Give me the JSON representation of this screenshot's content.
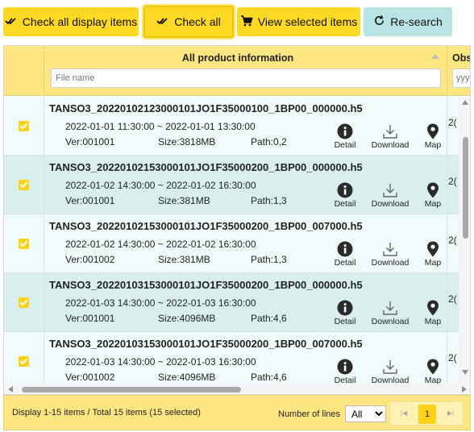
{
  "toolbar": {
    "check_all_display_label": "Check all display items",
    "check_all_label": "Check all",
    "view_selected_label": "View selected items",
    "research_label": "Re-search"
  },
  "grid": {
    "columns": {
      "main_title": "All product information",
      "obs_title": "Obs",
      "filter_placeholder": "File name",
      "obs_placeholder": "yyyy"
    },
    "action_labels": {
      "detail": "Detail",
      "download": "Download",
      "map": "Map"
    },
    "rows": [
      {
        "checked": true,
        "filename": "TANSO3_20220102123000101JO1F35000100_1BP00_000000.h5",
        "datetime": "2022-01-01 11:30:00 ~ 2022-01-01 13:30:00",
        "ver": "Ver:001001",
        "size": "Size:3818MB",
        "path": "Path:0,2",
        "obs": "2("
      },
      {
        "checked": true,
        "filename": "TANSO3_20220102153000101JO1F35000200_1BP00_000000.h5",
        "datetime": "2022-01-02 14:30:00 ~ 2022-01-02 16:30:00",
        "ver": "Ver:001001",
        "size": "Size:381MB",
        "path": "Path:1,3",
        "obs": "2("
      },
      {
        "checked": true,
        "filename": "TANSO3_20220102153000101JO1F35000200_1BP00_007000.h5",
        "datetime": "2022-01-02 14:30:00 ~ 2022-01-02 16:30:00",
        "ver": "Ver:001002",
        "size": "Size:381MB",
        "path": "Path:1,3",
        "obs": "2("
      },
      {
        "checked": true,
        "filename": "TANSO3_20220103153000101JO1F35000200_1BP00_000000.h5",
        "datetime": "2022-01-03 14:30:00 ~ 2022-01-03 16:30:00",
        "ver": "Ver:001001",
        "size": "Size:4096MB",
        "path": "Path:4,6",
        "obs": "2("
      },
      {
        "checked": true,
        "filename": "TANSO3_20220103153000101JO1F35000200_1BP00_007000.h5",
        "datetime": "2022-01-03 14:30:00 ~ 2022-01-03 16:30:00",
        "ver": "Ver:001002",
        "size": "Size:4096MB",
        "path": "Path:4,6",
        "obs": "2("
      }
    ]
  },
  "footer": {
    "display_info": "Display 1-15 items / Total 15 items (15 selected)",
    "number_of_lines_label": "Number of lines",
    "number_of_lines_value": "All",
    "current_page": "1"
  },
  "colors": {
    "accent_yellow": "#ffd924",
    "header_yellow": "#ffe680",
    "research_cyan": "#b9e4e4",
    "row_light": "#f0fbfb",
    "row_dark": "#d8efee"
  }
}
